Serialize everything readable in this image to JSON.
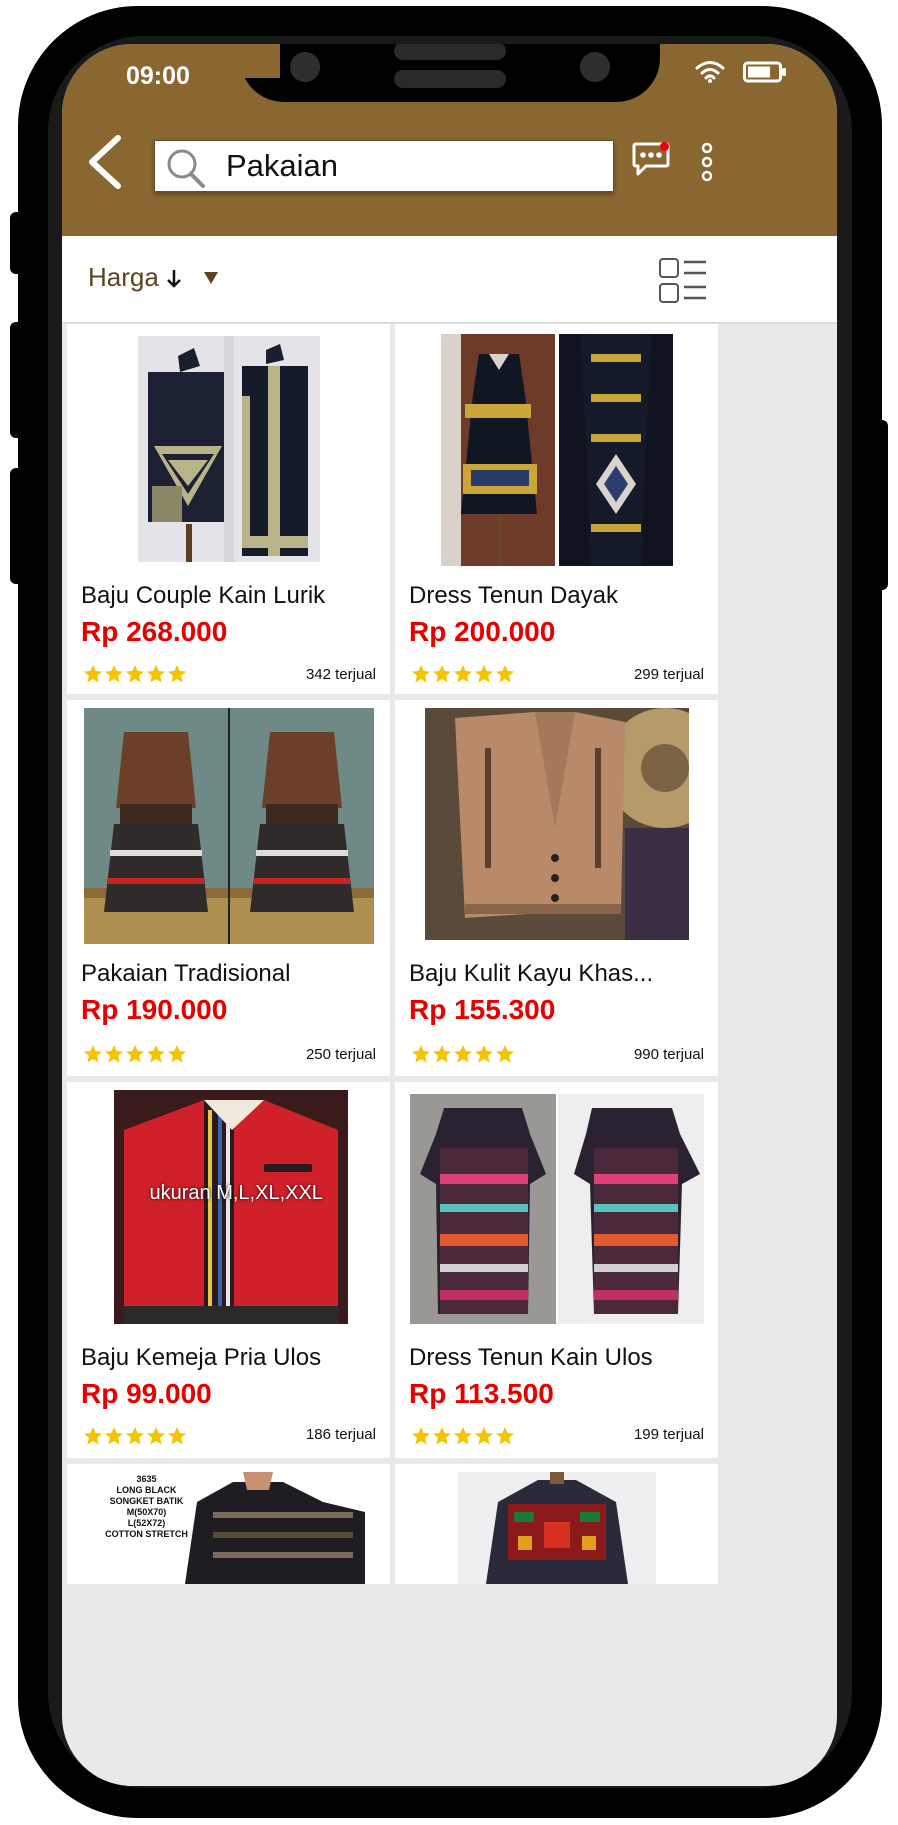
{
  "status": {
    "time": "09:00"
  },
  "search": {
    "query": "Pakaian"
  },
  "filter": {
    "sort_label": "Harga"
  },
  "colors": {
    "brand": "#8a6631",
    "price": "#e60000",
    "star": "#f5c300"
  },
  "products": [
    {
      "title": "Baju Couple Kain Lurik",
      "price": "Rp 268.000",
      "rating": 5,
      "sold": "342 terjual"
    },
    {
      "title": "Dress Tenun Dayak",
      "price": "Rp 200.000",
      "rating": 5,
      "sold": "299 terjual"
    },
    {
      "title": "Pakaian Tradisional",
      "price": "Rp 190.000",
      "rating": 5,
      "sold": "250 terjual"
    },
    {
      "title": "Baju Kulit Kayu Khas...",
      "price": "Rp 155.300",
      "rating": 5,
      "sold": "990 terjual"
    },
    {
      "title": "Baju Kemeja Pria Ulos",
      "price": "Rp 99.000",
      "rating": 5,
      "sold": "186 terjual",
      "image_caption": "ukuran M,L,XL,XXL"
    },
    {
      "title": "Dress Tenun Kain Ulos",
      "price": "Rp 113.500",
      "rating": 5,
      "sold": "199 terjual"
    },
    {
      "image_text": "3635\nLONG BLACK\nSONGKET BATIK\nM(50X70)\nL(52X72)\nCOTTON STRETCH"
    },
    {}
  ]
}
